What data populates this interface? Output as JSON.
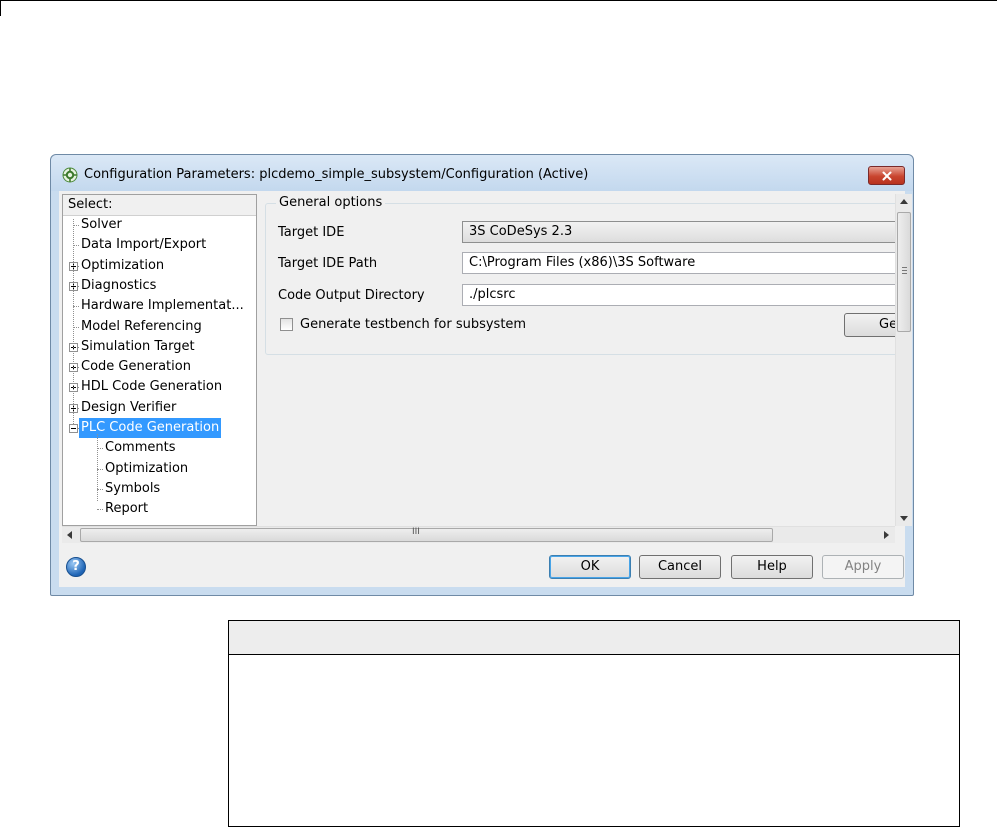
{
  "dialog": {
    "title": "Configuration Parameters: plcdemo_simple_subsystem/Configuration (Active)"
  },
  "tree": {
    "header": "Select:",
    "items": [
      {
        "label": "Solver",
        "level": 0,
        "expander": "none"
      },
      {
        "label": "Data Import/Export",
        "level": 0,
        "expander": "none"
      },
      {
        "label": "Optimization",
        "level": 0,
        "expander": "plus"
      },
      {
        "label": "Diagnostics",
        "level": 0,
        "expander": "plus"
      },
      {
        "label": "Hardware Implementat...",
        "level": 0,
        "expander": "none"
      },
      {
        "label": "Model Referencing",
        "level": 0,
        "expander": "none"
      },
      {
        "label": "Simulation Target",
        "level": 0,
        "expander": "plus"
      },
      {
        "label": "Code Generation",
        "level": 0,
        "expander": "plus"
      },
      {
        "label": "HDL Code Generation",
        "level": 0,
        "expander": "plus"
      },
      {
        "label": "Design Verifier",
        "level": 0,
        "expander": "plus"
      },
      {
        "label": "PLC Code Generation",
        "level": 0,
        "expander": "minus",
        "selected": true
      },
      {
        "label": "Comments",
        "level": 1,
        "expander": "none"
      },
      {
        "label": "Optimization",
        "level": 1,
        "expander": "none"
      },
      {
        "label": "Symbols",
        "level": 1,
        "expander": "none"
      },
      {
        "label": "Report",
        "level": 1,
        "expander": "none"
      }
    ]
  },
  "general_options": {
    "legend": "General options",
    "target_ide_label": "Target IDE",
    "target_ide_value": "3S CoDeSys 2.3",
    "target_ide_path_label": "Target IDE Path",
    "target_ide_path_value": "C:\\Program Files (x86)\\3S Software",
    "code_output_dir_label": "Code Output Directory",
    "code_output_dir_value": "./plcsrc",
    "testbench_label": "Generate testbench for subsystem",
    "testbench_checked": false,
    "generate_button_partial": "Ge"
  },
  "buttons": {
    "ok": "OK",
    "cancel": "Cancel",
    "help": "Help",
    "apply": "Apply"
  },
  "help_icon_glyph": "?",
  "scroll_grip_glyph": "III",
  "colors": {
    "selection": "#3399ff",
    "close_button": "#c9452f",
    "dialog_frame": "#c9dcef"
  }
}
